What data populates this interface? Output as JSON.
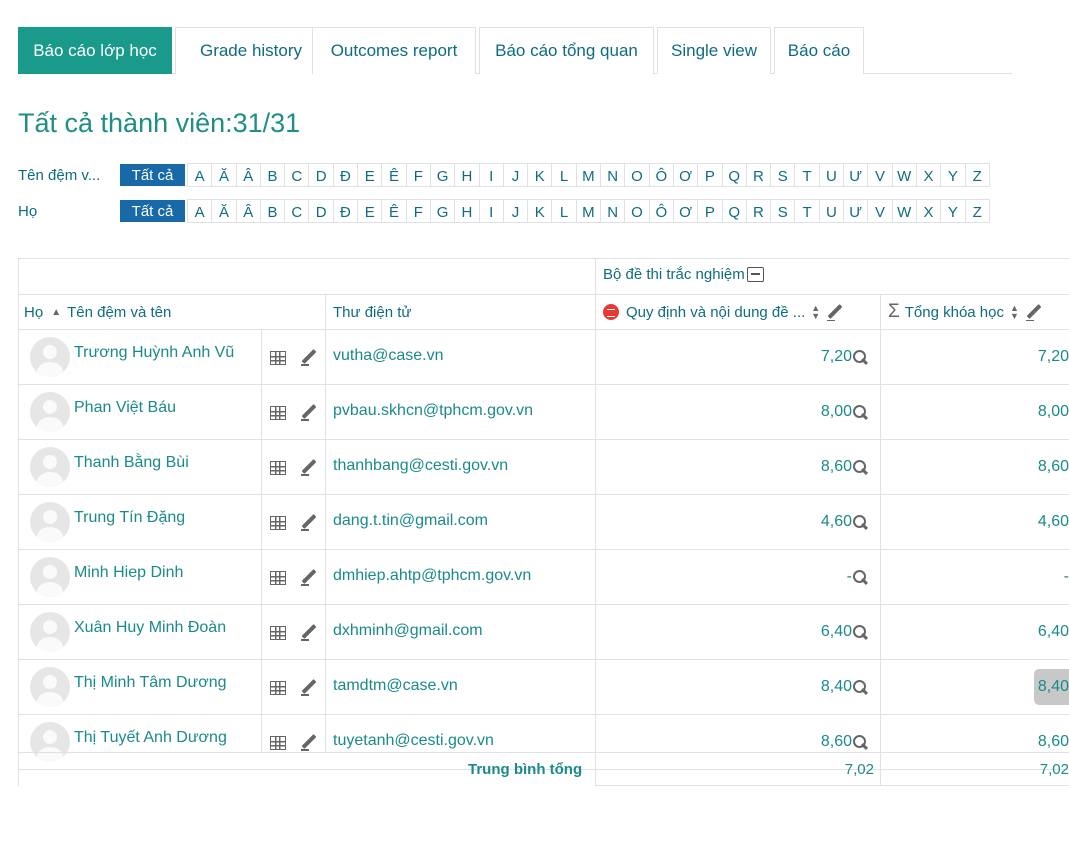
{
  "tabs": [
    {
      "label": "Báo cáo lớp học",
      "active": true
    },
    {
      "label": "Grade history",
      "active": false
    },
    {
      "label": "Outcomes report",
      "active": false
    },
    {
      "label": "Báo cáo tổng quan",
      "active": false
    },
    {
      "label": "Single view",
      "active": false
    },
    {
      "label": "Báo cáo",
      "active": false
    }
  ],
  "page_title": "Tất cả thành viên:31/31",
  "initials_bars": [
    {
      "label": "Tên đệm v...",
      "all_label": "Tất cả"
    },
    {
      "label": "Họ",
      "all_label": "Tất cả"
    }
  ],
  "letters": [
    "A",
    "Ă",
    "Â",
    "B",
    "C",
    "D",
    "Đ",
    "E",
    "Ê",
    "F",
    "G",
    "H",
    "I",
    "J",
    "K",
    "L",
    "M",
    "N",
    "O",
    "Ô",
    "Ơ",
    "P",
    "Q",
    "R",
    "S",
    "T",
    "U",
    "Ư",
    "V",
    "W",
    "X",
    "Y",
    "Z"
  ],
  "table": {
    "category_header": "Bộ đề thi trắc nghiệm",
    "col_surname": "Họ",
    "col_name": "Tên đệm và tên",
    "col_email": "Thư điện tử",
    "col_quiz": "Quy định và nội dung đề ...",
    "col_total": "Tổng khóa học",
    "rows": [
      {
        "name": "Trương Huỳnh Anh Vũ",
        "email": "vutha@case.vn",
        "grade": "7,20",
        "total": "7,20"
      },
      {
        "name": "Phan Việt Báu",
        "email": "pvbau.skhcn@tphcm.gov.vn",
        "grade": "8,00",
        "total": "8,00"
      },
      {
        "name": "Thanh Bằng Bùi",
        "email": "thanhbang@cesti.gov.vn",
        "grade": "8,60",
        "total": "8,60"
      },
      {
        "name": "Trung Tín Đặng",
        "email": "dang.t.tin@gmail.com",
        "grade": "4,60",
        "total": "4,60"
      },
      {
        "name": "Minh Hiep Dinh",
        "email": "dmhiep.ahtp@tphcm.gov.vn",
        "grade": "-",
        "total": "-"
      },
      {
        "name": "Xuân Huy Minh Đoàn",
        "email": "dxhminh@gmail.com",
        "grade": "6,40",
        "total": "6,40"
      },
      {
        "name": "Thị Minh Tâm Dương",
        "email": "tamdtm@case.vn",
        "grade": "8,40",
        "total": "8,40"
      },
      {
        "name": "Thị Tuyết Anh Dương",
        "email": "tuyetanh@cesti.gov.vn",
        "grade": "8,60",
        "total": "8,60"
      }
    ],
    "footer_label": "Trung bình tổng",
    "footer_quiz": "7,02",
    "footer_total": "7,02"
  },
  "colors": {
    "accent": "#1a9a8a",
    "initials_all": "#1769a8",
    "link": "#0f6c80"
  }
}
